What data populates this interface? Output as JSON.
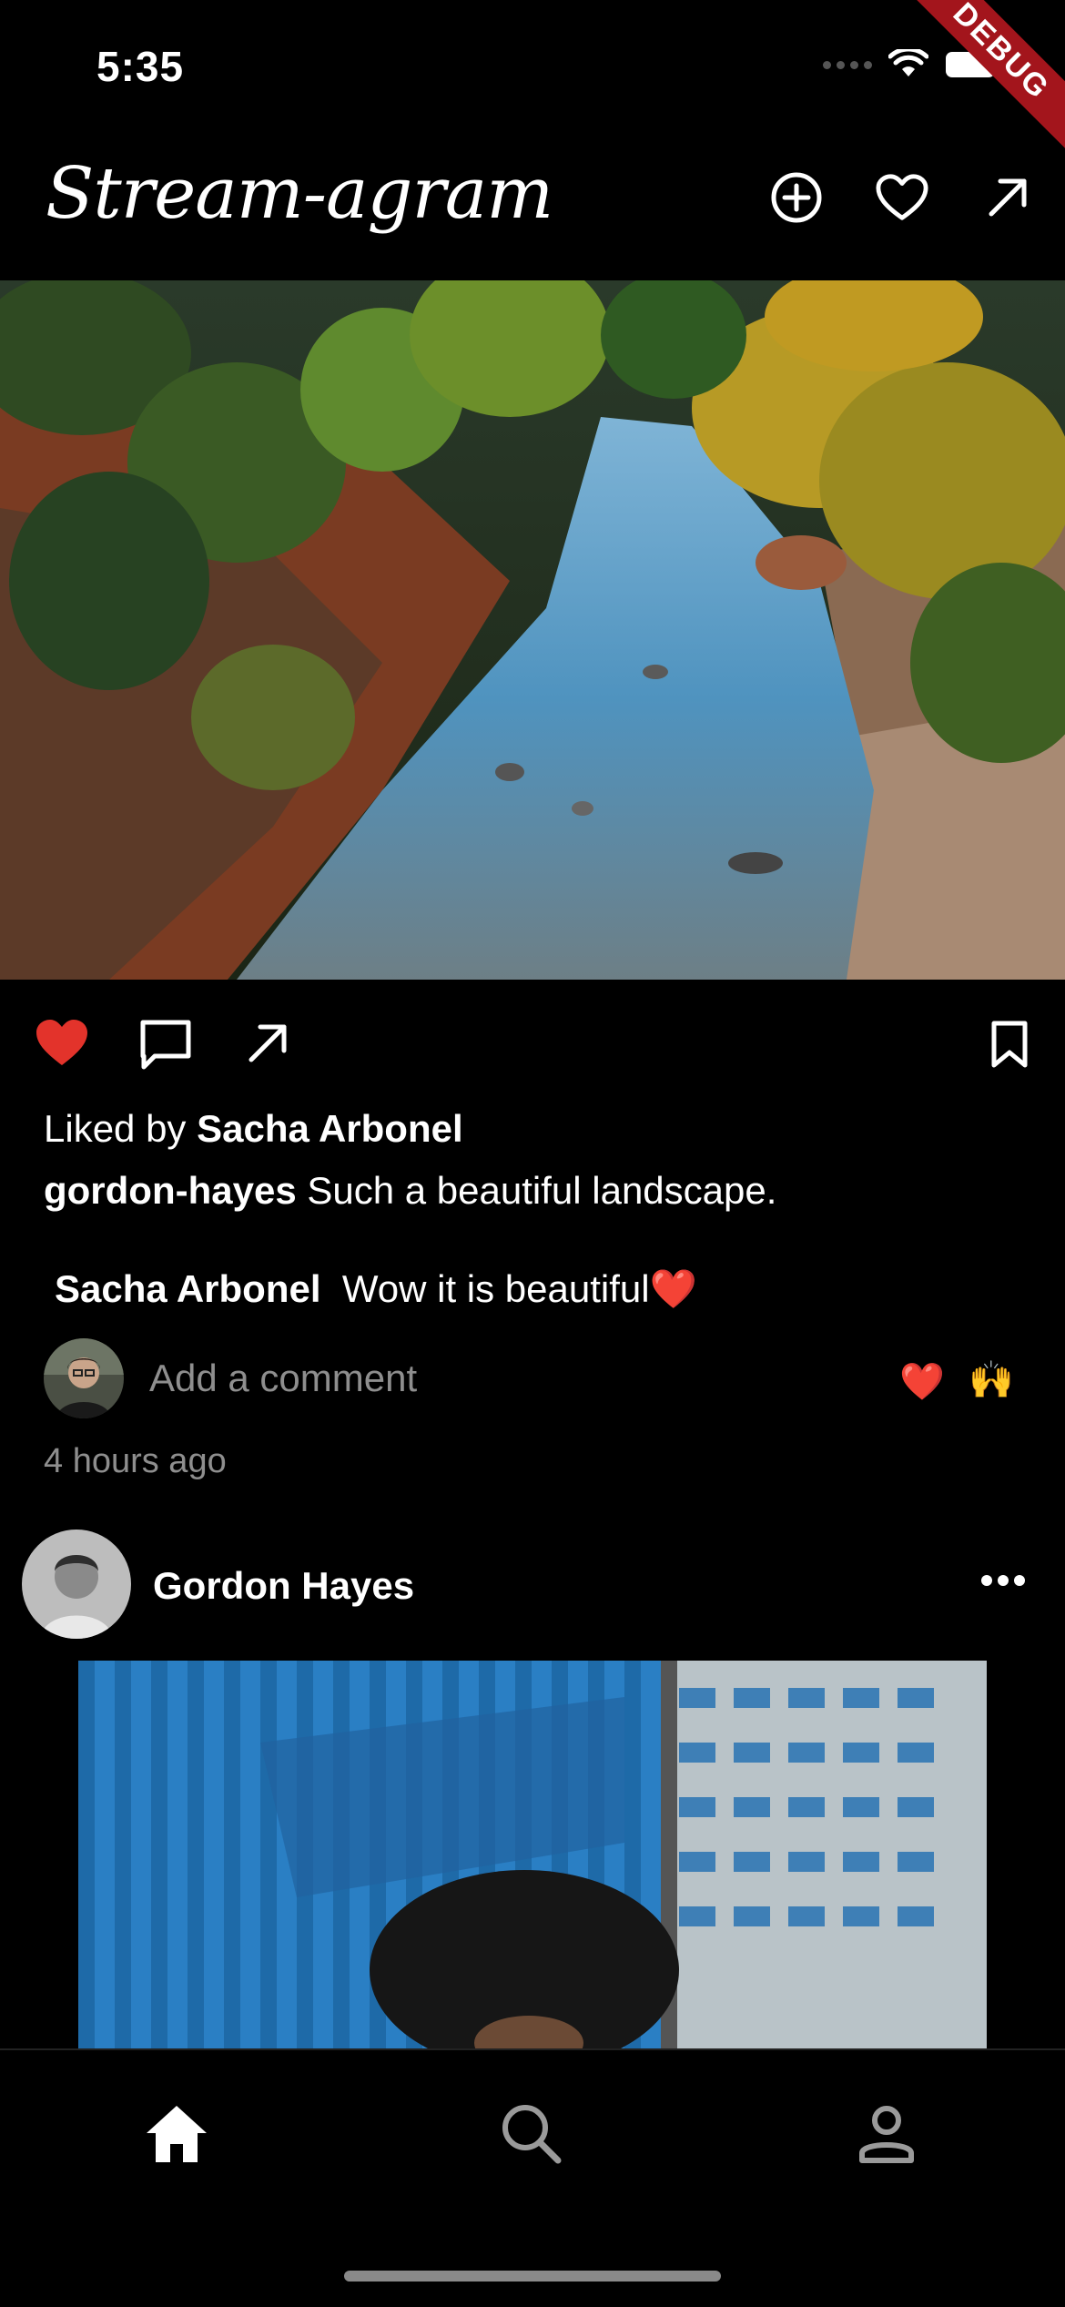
{
  "status_bar": {
    "time": "5:35",
    "debug_label": "DEBUG"
  },
  "app_bar": {
    "title": "Stream-agram"
  },
  "post1": {
    "liked_by_prefix": "Liked by",
    "liked_by_user": "Sacha Arbonel",
    "caption_user": "gordon-hayes",
    "caption_text": "Such a beautiful landscape.",
    "comment_user": "Sacha Arbonel",
    "comment_text": "Wow it is beautiful❤️",
    "add_comment_placeholder": "Add a comment",
    "quick_emoji_1": "❤️",
    "quick_emoji_2": "🙌",
    "timestamp": "4 hours ago",
    "liked": true
  },
  "post2": {
    "author": "Gordon Hayes"
  },
  "colors": {
    "like_red": "#e3332b",
    "background": "#000000"
  },
  "icons": [
    "add-circle-icon",
    "heart-outline-icon",
    "send-arrow-icon",
    "heart-filled-icon",
    "comment-icon",
    "share-arrow-icon",
    "bookmark-icon",
    "more-dots-icon",
    "home-icon",
    "search-icon",
    "profile-icon"
  ]
}
